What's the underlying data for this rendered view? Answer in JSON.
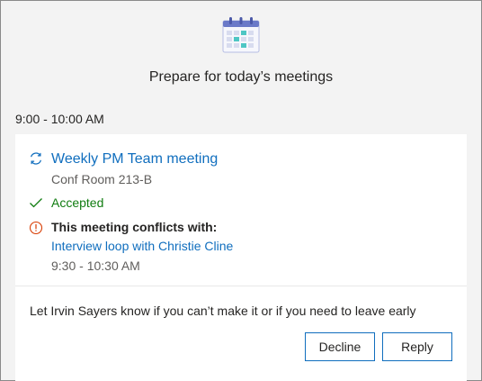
{
  "header": {
    "icon": "calendar-icon",
    "title": "Prepare for today’s meetings"
  },
  "time_range": "9:00 - 10:00 AM",
  "meeting": {
    "recurring_icon": "recurring-icon",
    "title": "Weekly PM Team meeting",
    "location": "Conf Room 213-B",
    "status_icon": "checkmark-icon",
    "status": "Accepted",
    "conflict_icon": "warning-info-icon",
    "conflict_label": "This meeting conflicts with:",
    "conflict_meeting": "Interview loop with Christie Cline",
    "conflict_time": "9:30 - 10:30 AM"
  },
  "notice": "Let Irvin Sayers know if you can’t make it or if you need to leave early",
  "actions": {
    "decline_label": "Decline",
    "reply_label": "Reply"
  },
  "colors": {
    "link": "#106ebe",
    "accepted": "#107c10",
    "conflict": "#d83b01",
    "calendar_header": "#6a79c8",
    "calendar_cell": "#d8dcef",
    "calendar_accent": "#4ec6c4"
  }
}
